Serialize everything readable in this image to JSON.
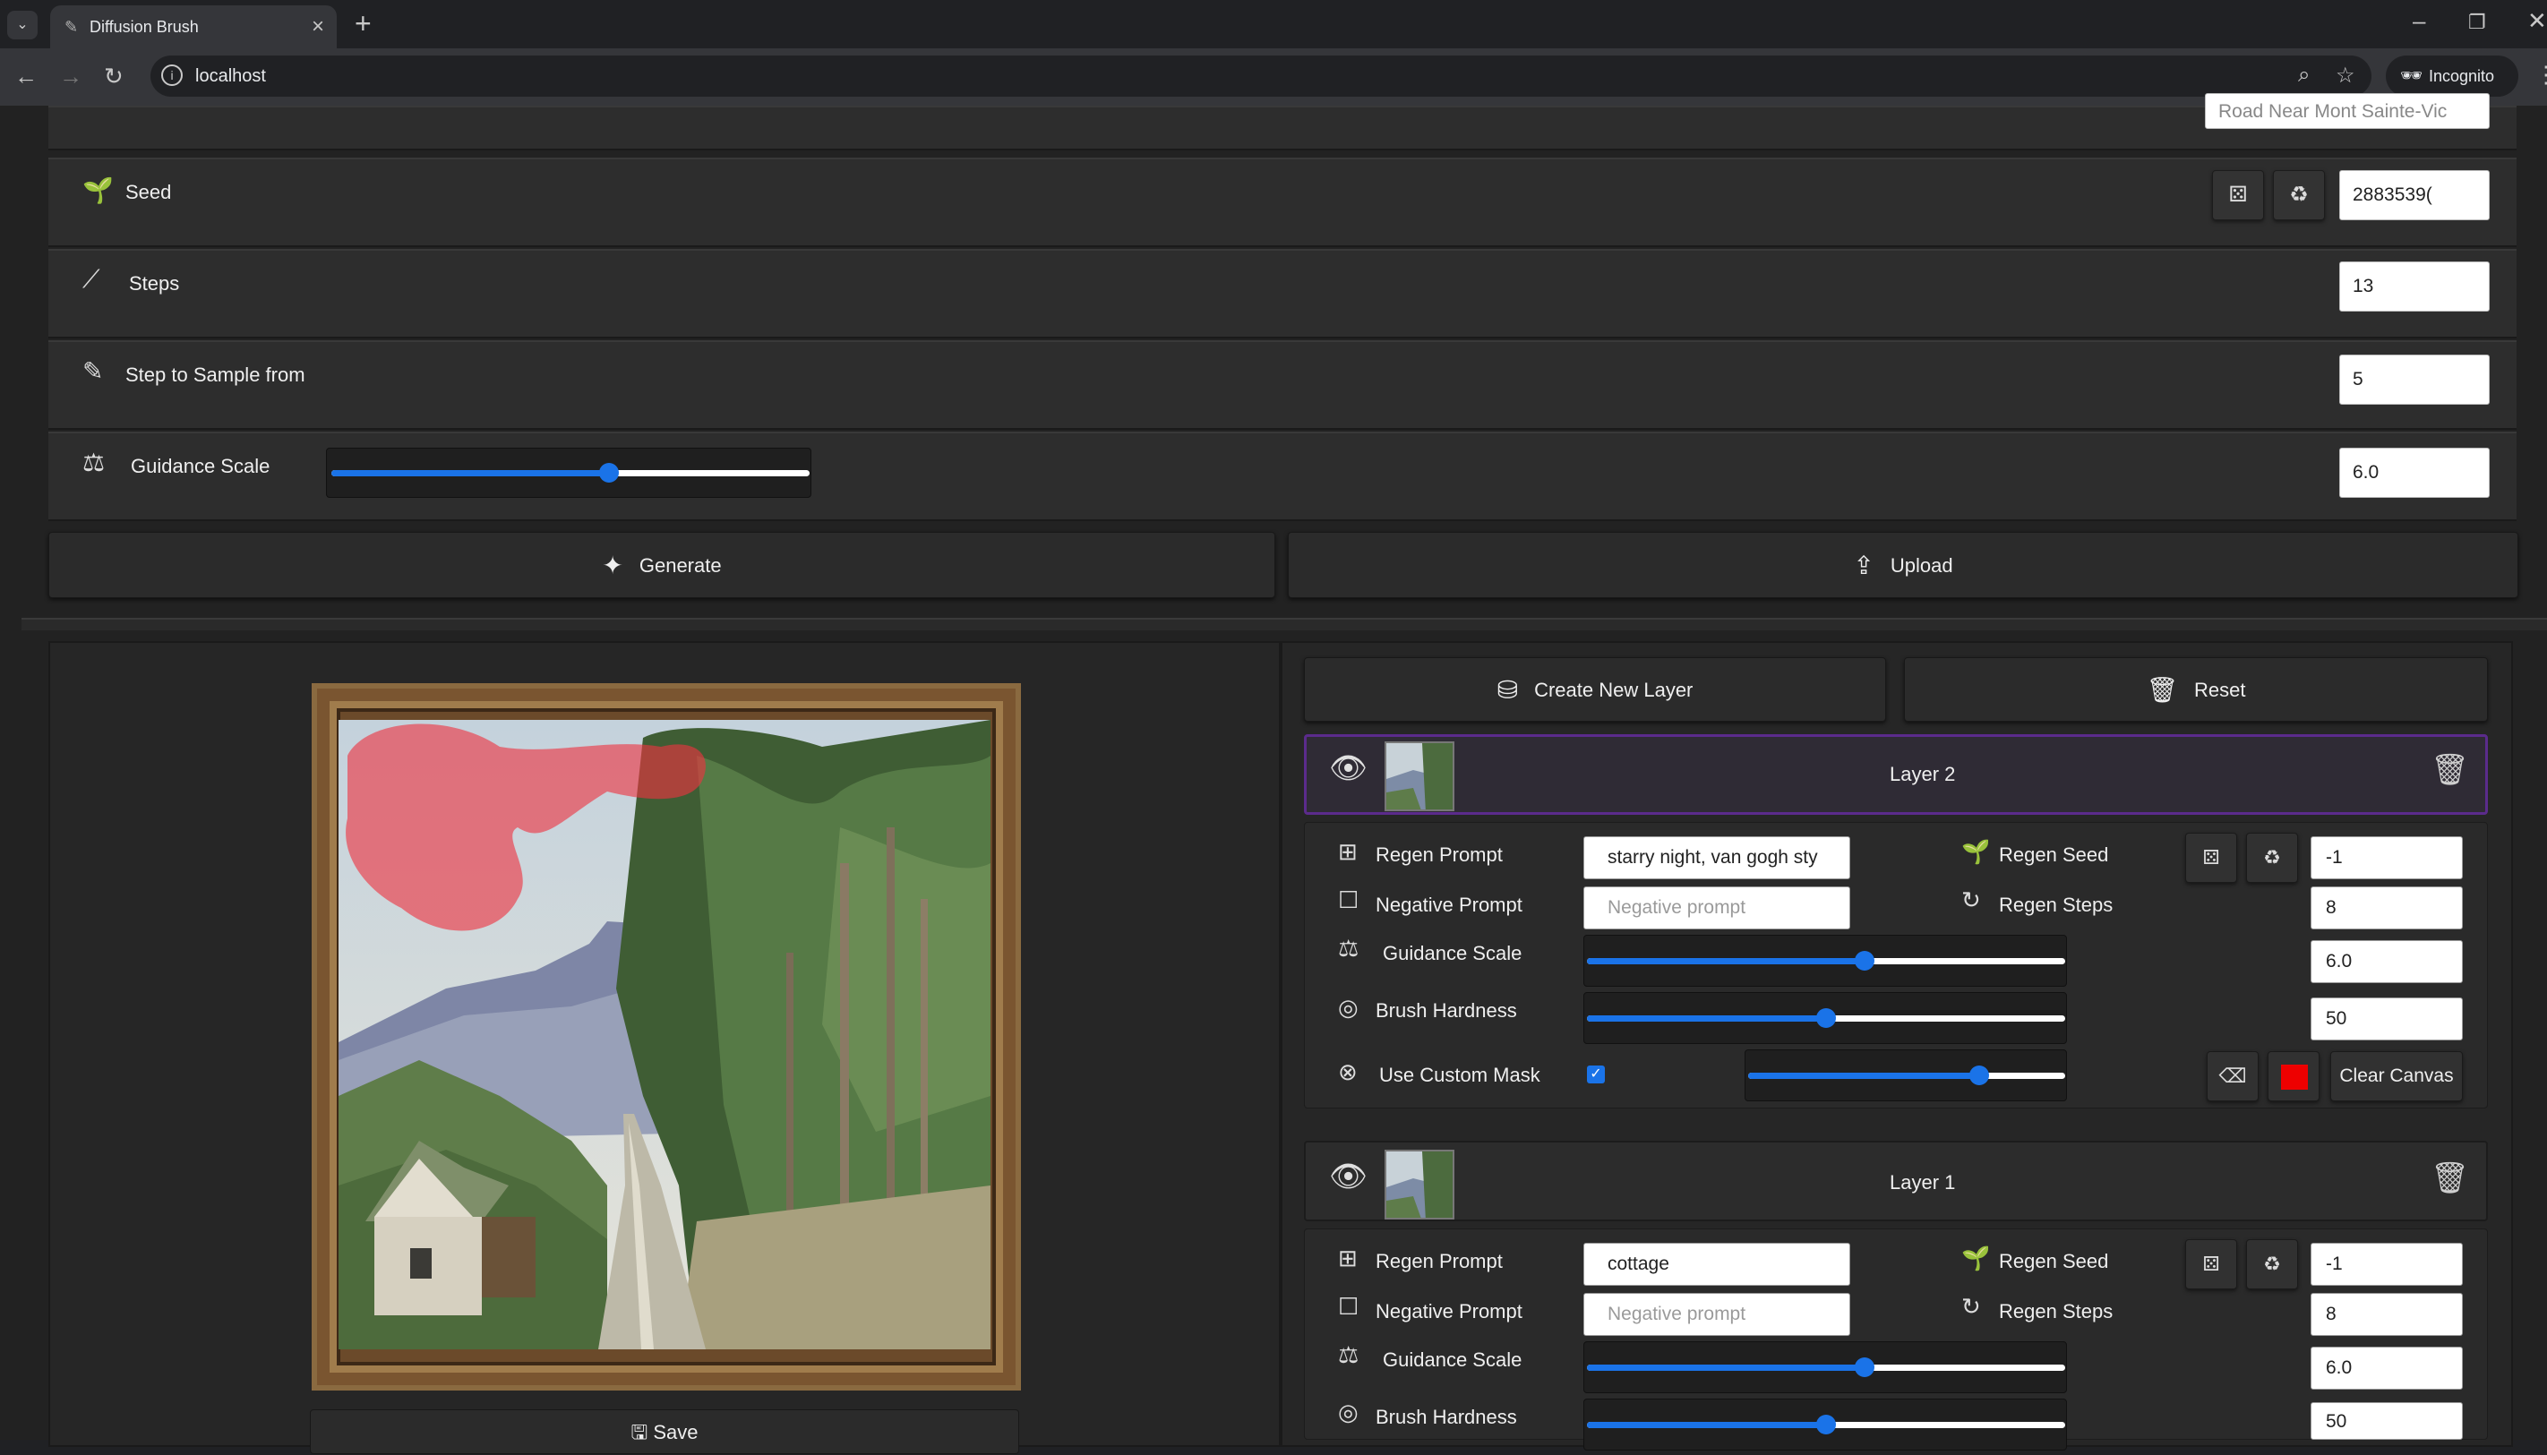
{
  "browser": {
    "tab_title": "Diffusion Brush",
    "url": "localhost",
    "incognito_label": "Incognito"
  },
  "settings": {
    "top_partial_value": "Road Near Mont Sainte-Vic",
    "seed": {
      "label": "Seed",
      "value": "2883539("
    },
    "steps": {
      "label": "Steps",
      "value": "13"
    },
    "step_sample": {
      "label": "Step to Sample from",
      "value": "5"
    },
    "guidance": {
      "label": "Guidance Scale",
      "value": "6.0",
      "slider_fraction": 0.58
    }
  },
  "actions": {
    "generate": "Generate",
    "upload": "Upload",
    "create_layer": "Create New Layer",
    "reset": "Reset",
    "save": "Save"
  },
  "labels": {
    "regen_prompt": "Regen Prompt",
    "negative_prompt": "Negative Prompt",
    "guidance_scale": "Guidance Scale",
    "brush_hardness": "Brush Hardness",
    "use_custom_mask": "Use Custom Mask",
    "regen_seed": "Regen Seed",
    "regen_steps": "Regen Steps",
    "clear_canvas": "Clear Canvas",
    "negative_placeholder": "Negative prompt"
  },
  "layers": [
    {
      "name": "Layer 2",
      "prompt": "starry night, van gogh sty",
      "regen_seed": "-1",
      "regen_steps": "8",
      "guidance": "6.0",
      "guidance_fraction": 0.58,
      "hardness": "50",
      "hardness_fraction": 0.5,
      "mask_fraction": 0.73,
      "use_custom_mask": true,
      "brush_color": "#ee0000"
    },
    {
      "name": "Layer 1",
      "prompt": "cottage",
      "regen_seed": "-1",
      "regen_steps": "8",
      "guidance": "6.0",
      "guidance_fraction": 0.58,
      "hardness": "50",
      "hardness_fraction": 0.5
    }
  ],
  "colors": {
    "accent": "#1a73e8",
    "active_layer_border": "#5b2b8c",
    "mask": "#ee3340"
  }
}
